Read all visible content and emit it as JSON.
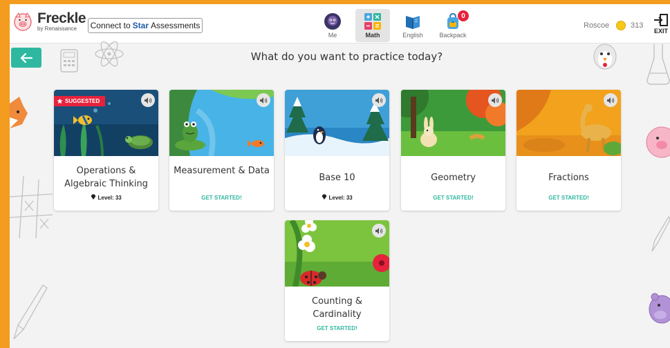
{
  "app": {
    "logo_title": "Freckle",
    "logo_subtitle": "by Renaissance"
  },
  "header": {
    "connect_prefix": "Connect to",
    "connect_star": "Star",
    "connect_suffix": "Assessments",
    "nav": [
      {
        "label": "Me",
        "icon": "avatar-icon",
        "active": false
      },
      {
        "label": "Math",
        "icon": "math-icon",
        "active": true
      },
      {
        "label": "English",
        "icon": "book-icon",
        "active": false
      },
      {
        "label": "Backpack",
        "icon": "backpack-icon",
        "active": false,
        "badge": "0"
      }
    ],
    "user_name": "Roscoe",
    "coins": "313",
    "exit_label": "EXIT"
  },
  "main": {
    "heading": "What do you want to practice today?",
    "back_icon": "arrow-left-icon",
    "cards": [
      {
        "title": "Operations & Algebraic Thinking",
        "meta": "Level: 33",
        "meta_type": "level",
        "suggested": "SUGGESTED",
        "scene": "underwater"
      },
      {
        "title": "Measurement & Data",
        "meta": "GET STARTED!",
        "meta_type": "start",
        "scene": "pond"
      },
      {
        "title": "Base 10",
        "meta": "Level: 33",
        "meta_type": "level",
        "scene": "snow"
      },
      {
        "title": "Geometry",
        "meta": "GET STARTED!",
        "meta_type": "start",
        "scene": "forest"
      },
      {
        "title": "Fractions",
        "meta": "GET STARTED!",
        "meta_type": "start",
        "scene": "desert"
      },
      {
        "title": "Counting & Cardinality",
        "meta": "GET STARTED!",
        "meta_type": "start",
        "scene": "garden"
      }
    ]
  },
  "colors": {
    "frame": "#f39c1f",
    "accent": "#2fb8a0",
    "suggested": "#e5233d",
    "link": "#1d5aa6"
  }
}
